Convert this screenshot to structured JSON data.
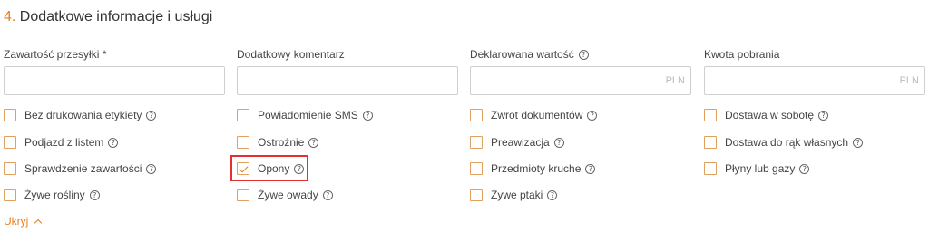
{
  "section": {
    "number": "4.",
    "title": "Dodatkowe informacje i usługi"
  },
  "fields": [
    {
      "label": "Zawartość przesyłki *",
      "help": false,
      "value": "",
      "suffix": ""
    },
    {
      "label": "Dodatkowy komentarz",
      "help": false,
      "value": "",
      "suffix": ""
    },
    {
      "label": "Deklarowana wartość",
      "help": true,
      "value": "",
      "suffix": "PLN"
    },
    {
      "label": "Kwota pobrania",
      "help": false,
      "value": "",
      "suffix": "PLN"
    }
  ],
  "options": {
    "col1": [
      {
        "label": "Bez drukowania etykiety",
        "checked": false
      },
      {
        "label": "Podjazd z listem",
        "checked": false
      },
      {
        "label": "Sprawdzenie zawartości",
        "checked": false
      },
      {
        "label": "Żywe rośliny",
        "checked": false
      }
    ],
    "col2": [
      {
        "label": "Powiadomienie SMS",
        "checked": false
      },
      {
        "label": "Ostrożnie",
        "checked": false
      },
      {
        "label": "Opony",
        "checked": true
      },
      {
        "label": "Żywe owady",
        "checked": false
      }
    ],
    "col3": [
      {
        "label": "Zwrot dokumentów",
        "checked": false
      },
      {
        "label": "Preawizacja",
        "checked": false
      },
      {
        "label": "Przedmioty kruche",
        "checked": false
      },
      {
        "label": "Żywe ptaki",
        "checked": false
      }
    ],
    "col4": [
      {
        "label": "Dostawa w sobotę",
        "checked": false
      },
      {
        "label": "Dostawa do rąk własnych",
        "checked": false
      },
      {
        "label": "Płyny lub gazy",
        "checked": false
      }
    ]
  },
  "help_glyph": "?",
  "hide_label": "Ukryj",
  "colors": {
    "accent": "#e67e22",
    "highlight": "#e53030"
  }
}
